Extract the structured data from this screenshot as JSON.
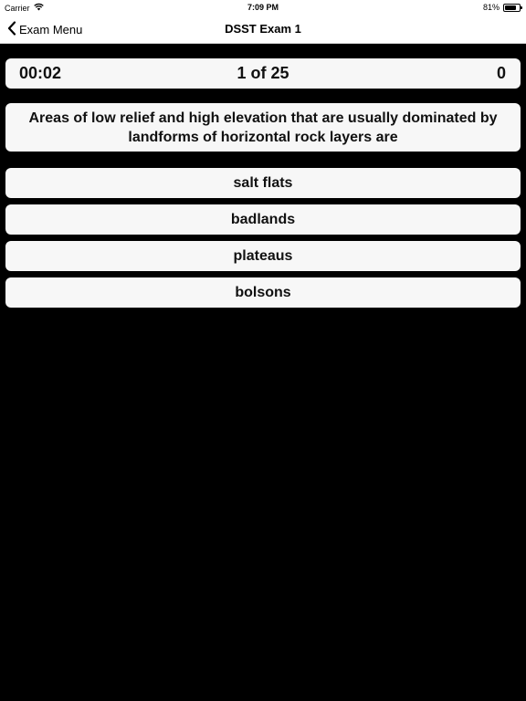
{
  "status_bar": {
    "carrier": "Carrier",
    "time": "7:09 PM",
    "battery_text": "81%",
    "battery_level": 0.81
  },
  "nav": {
    "back_label": "Exam Menu",
    "title": "DSST Exam 1"
  },
  "exam": {
    "timer": "00:02",
    "progress": "1 of 25",
    "score": "0",
    "question": "Areas of low relief and high elevation that are usually dominated by landforms of horizontal rock layers are",
    "answers": [
      "salt flats",
      "badlands",
      "plateaus",
      "bolsons"
    ]
  }
}
